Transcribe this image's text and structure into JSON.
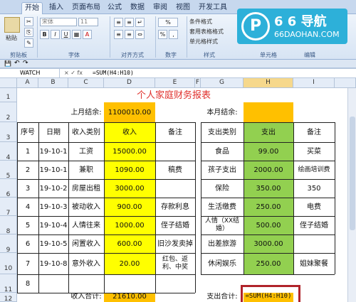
{
  "tabs": [
    "开始",
    "插入",
    "页面布局",
    "公式",
    "数据",
    "审阅",
    "视图",
    "开发工具"
  ],
  "ribbon": {
    "paste": "粘贴",
    "clipboard": "剪贴板",
    "font_label": "字体",
    "align_label": "对齐方式",
    "number_label": "数字",
    "style_label": "样式",
    "cells_label": "单元格",
    "edit_label": "编辑",
    "font_name": "宋体",
    "font_size": "11",
    "cond_fmt": "条件格式",
    "table_fmt": "套用表格格式",
    "cell_style": "单元格样式"
  },
  "logo": {
    "title": "6 6 导航",
    "url": "66DAOHAN.COM"
  },
  "formula_bar": {
    "name_box": "WATCH",
    "formula": "=SUM(H4:H10)",
    "symbols": "× ✓ fx"
  },
  "columns": [
    "A",
    "B",
    "C",
    "D",
    "E",
    "F",
    "G",
    "H",
    "I"
  ],
  "rows": [
    "1",
    "2",
    "3",
    "4",
    "5",
    "6",
    "7",
    "8",
    "9",
    "10",
    "11",
    "12"
  ],
  "sheet": {
    "title": "个人家庭财务报表",
    "last_balance_label": "上月结余:",
    "last_balance_value": "1100010.00",
    "this_balance_label": "本月结余:",
    "income_headers": [
      "序号",
      "日期",
      "收入类别",
      "收入",
      "备注"
    ],
    "expense_headers": [
      "支出类别",
      "支出",
      "备注"
    ],
    "income_rows": [
      [
        "1",
        "19-10-1",
        "工资",
        "15000.00",
        ""
      ],
      [
        "2",
        "19-10-1",
        "兼职",
        "1090.00",
        "稿费"
      ],
      [
        "3",
        "19-10-2",
        "房屋出租",
        "3000.00",
        ""
      ],
      [
        "4",
        "19-10-3",
        "被动收入",
        "900.00",
        "存款利息"
      ],
      [
        "5",
        "19-10-4",
        "人情往来",
        "1000.00",
        "侄子结婚"
      ],
      [
        "6",
        "19-10-5",
        "闲置收入",
        "600.00",
        "旧沙发卖掉"
      ],
      [
        "7",
        "19-10-8",
        "意外收入",
        "20.00",
        "红包、返利、中奖"
      ],
      [
        "8",
        "",
        "",
        "",
        ""
      ]
    ],
    "expense_rows": [
      [
        "食品",
        "99.00",
        "买菜"
      ],
      [
        "孩子支出",
        "2000.00",
        "绘画培训费"
      ],
      [
        "保险",
        "350.00",
        "350"
      ],
      [
        "生活缴费",
        "250.00",
        "电费"
      ],
      [
        "人情（XX结婚）",
        "500.00",
        "侄子结婚"
      ],
      [
        "出差旅游",
        "3000.00",
        ""
      ],
      [
        "休闲娱乐",
        "250.00",
        "姐妹聚餐"
      ]
    ],
    "income_total_label": "收入合计:",
    "income_total_value": "21610.00",
    "expense_total_label": "支出合计:",
    "expense_total_formula": "=SUM(H4:H10)"
  }
}
